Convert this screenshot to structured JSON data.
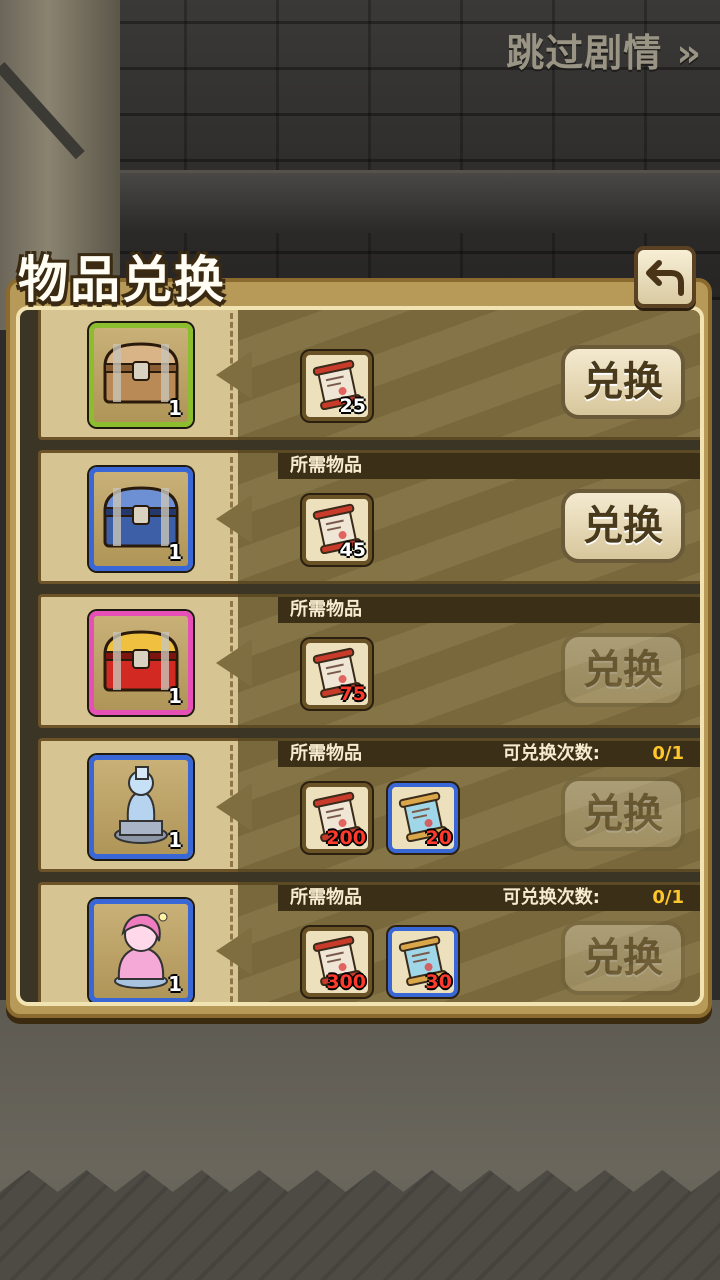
{
  "skip_label": "跳过剧情 »",
  "panel_title": "物品兑换",
  "back_icon": "return-arrow-icon",
  "required_label": "所需物品",
  "limit_label": "可兑换次数:",
  "exchange_label": "兑换",
  "rows": [
    {
      "reward": {
        "icon": "wooden-chest-icon",
        "count": "1",
        "frame_color": "#8bbd2e"
      },
      "costs": [
        {
          "icon": "red-scroll-icon",
          "amount": "25",
          "enough": true
        }
      ],
      "limit": "",
      "button_enabled": true
    },
    {
      "reward": {
        "icon": "blue-chest-icon",
        "count": "1",
        "frame_color": "#3a67d6"
      },
      "costs": [
        {
          "icon": "red-scroll-icon",
          "amount": "45",
          "enough": true
        }
      ],
      "limit": "",
      "button_enabled": true
    },
    {
      "reward": {
        "icon": "red-chest-icon",
        "count": "1",
        "frame_color": "#e54fb6"
      },
      "costs": [
        {
          "icon": "red-scroll-icon",
          "amount": "75",
          "enough": false
        }
      ],
      "limit": "",
      "button_enabled": false
    },
    {
      "reward": {
        "icon": "blue-statue-icon",
        "count": "1",
        "frame_color": "#3a67d6"
      },
      "costs": [
        {
          "icon": "red-scroll-icon",
          "amount": "200",
          "enough": false
        },
        {
          "icon": "blue-scroll-icon",
          "amount": "20",
          "enough": false
        }
      ],
      "limit": "0/1",
      "button_enabled": false
    },
    {
      "reward": {
        "icon": "pink-figure-icon",
        "count": "1",
        "frame_color": "#3a67d6"
      },
      "costs": [
        {
          "icon": "red-scroll-icon",
          "amount": "300",
          "enough": false
        },
        {
          "icon": "blue-scroll-icon",
          "amount": "30",
          "enough": false
        }
      ],
      "limit": "0/1",
      "button_enabled": false
    }
  ]
}
